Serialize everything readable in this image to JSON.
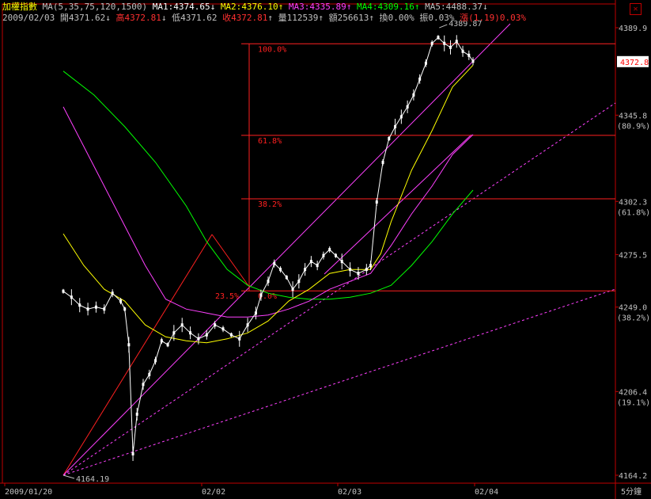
{
  "header": {
    "index_name": "加權指數",
    "ma_params": "MA(5,35,75,120,1500)",
    "ma1": {
      "label": "MA1:",
      "value": "4374.65",
      "arrow": "↓"
    },
    "ma2": {
      "label": "MA2:",
      "value": "4376.10",
      "arrow": "↑"
    },
    "ma3": {
      "label": "MA3:",
      "value": "4335.89",
      "arrow": "↑"
    },
    "ma4": {
      "label": "MA4:",
      "value": "4309.16",
      "arrow": "↑"
    },
    "ma5": {
      "label": "MA5:",
      "value": "4488.37",
      "arrow": "↓"
    },
    "date": "2009/02/03",
    "open": {
      "label": "開",
      "value": "4371.62",
      "arrow": "↓"
    },
    "high": {
      "label": "高",
      "value": "4372.81",
      "arrow": "↓"
    },
    "low": {
      "label": "低",
      "value": "4371.62"
    },
    "close": {
      "label": "收",
      "value": "4372.81",
      "arrow": "↑"
    },
    "volume": {
      "label": "量",
      "value": "112539",
      "arrow": "↑"
    },
    "amount": {
      "label": "額",
      "value": "256613",
      "arrow": "↑"
    },
    "turnover": {
      "label": "換",
      "value": "0.00%"
    },
    "amplitude": {
      "label": "振",
      "value": "0.03%"
    },
    "change": {
      "label": "漲",
      "value": "(1.19)",
      "pct": "0.03%"
    }
  },
  "period_label": "5分鐘",
  "close_icon": "close-icon",
  "colors": {
    "background": "#000000",
    "grid": "#c00000",
    "candle_up": "#ffffff",
    "candle_down": "#ffffff",
    "ma1": "#ffffff",
    "ma2": "#ffff00",
    "ma3": "#ff40ff",
    "ma4": "#00ff00",
    "ma5": "#00ff00",
    "fib": "#ff2020",
    "fan": "#ff40ff",
    "fan_red": "#ff2020",
    "axis_text": "#c0c0c0"
  },
  "chart_data": {
    "type": "line",
    "title": "加權指數",
    "y_ticks": [
      {
        "value": 4389.9,
        "label": "4389.9"
      },
      {
        "value": 4345.8,
        "label": "4345.8",
        "sub": "(80.9%)"
      },
      {
        "value": 4302.3,
        "label": "4302.3",
        "sub": "(61.8%)"
      },
      {
        "value": 4275.5,
        "label": "4275.5"
      },
      {
        "value": 4249.0,
        "label": "4249.0",
        "sub": "(38.2%)"
      },
      {
        "value": 4206.4,
        "label": "4206.4",
        "sub": "(19.1%)"
      },
      {
        "value": 4164.2,
        "label": "4164.2"
      }
    ],
    "current_price": "4372.8",
    "x_ticks": [
      {
        "label": "2009/01/20",
        "index": 0
      },
      {
        "label": "02/02",
        "index": 193
      },
      {
        "label": "02/03",
        "index": 306
      },
      {
        "label": "02/04",
        "index": 426
      }
    ],
    "x_count": 560,
    "annotations": {
      "high": {
        "text": "4389.87",
        "index": 367,
        "value": 4389.87
      },
      "low": {
        "text": "4164.19",
        "index": 0,
        "value": 4164.19
      }
    },
    "fib_levels": [
      {
        "label": "100.0%",
        "value": 4381.8
      },
      {
        "label": "61.8%",
        "value": 4335.6
      },
      {
        "label": "38.2%",
        "value": 4303.6
      },
      {
        "label": "23.5%",
        "value": 4257.2
      },
      {
        "label": "0.0%",
        "value": 4257.2
      }
    ],
    "close_series": [
      [
        0,
        4257
      ],
      [
        8,
        4254
      ],
      [
        16,
        4250
      ],
      [
        24,
        4248
      ],
      [
        32,
        4249
      ],
      [
        40,
        4248
      ],
      [
        48,
        4256
      ],
      [
        56,
        4252
      ],
      [
        60,
        4248
      ],
      [
        64,
        4230
      ],
      [
        68,
        4175
      ],
      [
        72,
        4195
      ],
      [
        78,
        4210
      ],
      [
        84,
        4215
      ],
      [
        90,
        4222
      ],
      [
        96,
        4232
      ],
      [
        102,
        4230
      ],
      [
        108,
        4236
      ],
      [
        116,
        4240
      ],
      [
        124,
        4236
      ],
      [
        132,
        4233
      ],
      [
        140,
        4235
      ],
      [
        148,
        4240
      ],
      [
        156,
        4238
      ],
      [
        164,
        4235
      ],
      [
        172,
        4233
      ],
      [
        180,
        4240
      ],
      [
        188,
        4246
      ],
      [
        193,
        4255
      ],
      [
        200,
        4262
      ],
      [
        206,
        4271
      ],
      [
        212,
        4268
      ],
      [
        218,
        4264
      ],
      [
        224,
        4258
      ],
      [
        230,
        4262
      ],
      [
        236,
        4268
      ],
      [
        242,
        4272
      ],
      [
        248,
        4270
      ],
      [
        254,
        4275
      ],
      [
        260,
        4278
      ],
      [
        266,
        4275
      ],
      [
        272,
        4272
      ],
      [
        280,
        4268
      ],
      [
        288,
        4266
      ],
      [
        296,
        4268
      ],
      [
        300,
        4270
      ],
      [
        306,
        4302
      ],
      [
        312,
        4322
      ],
      [
        318,
        4334
      ],
      [
        324,
        4340
      ],
      [
        330,
        4345
      ],
      [
        336,
        4350
      ],
      [
        342,
        4356
      ],
      [
        348,
        4364
      ],
      [
        354,
        4372
      ],
      [
        360,
        4382
      ],
      [
        366,
        4385
      ],
      [
        372,
        4382
      ],
      [
        378,
        4380
      ],
      [
        384,
        4383
      ],
      [
        390,
        4378
      ],
      [
        396,
        4376
      ],
      [
        400,
        4373
      ]
    ],
    "ma2_series": [
      [
        0,
        4286
      ],
      [
        20,
        4270
      ],
      [
        40,
        4258
      ],
      [
        60,
        4252
      ],
      [
        80,
        4240
      ],
      [
        100,
        4234
      ],
      [
        120,
        4232
      ],
      [
        140,
        4231
      ],
      [
        160,
        4233
      ],
      [
        180,
        4236
      ],
      [
        200,
        4242
      ],
      [
        220,
        4252
      ],
      [
        240,
        4258
      ],
      [
        260,
        4266
      ],
      [
        280,
        4268
      ],
      [
        300,
        4268
      ],
      [
        310,
        4276
      ],
      [
        320,
        4292
      ],
      [
        340,
        4318
      ],
      [
        360,
        4338
      ],
      [
        380,
        4360
      ],
      [
        400,
        4371
      ]
    ],
    "ma3_series": [
      [
        0,
        4350
      ],
      [
        20,
        4330
      ],
      [
        40,
        4310
      ],
      [
        60,
        4290
      ],
      [
        80,
        4270
      ],
      [
        100,
        4253
      ],
      [
        120,
        4248
      ],
      [
        140,
        4246
      ],
      [
        160,
        4244
      ],
      [
        180,
        4244
      ],
      [
        200,
        4245
      ],
      [
        220,
        4248
      ],
      [
        240,
        4252
      ],
      [
        260,
        4258
      ],
      [
        280,
        4262
      ],
      [
        300,
        4266
      ],
      [
        320,
        4280
      ],
      [
        340,
        4296
      ],
      [
        360,
        4310
      ],
      [
        380,
        4326
      ],
      [
        400,
        4336
      ]
    ],
    "ma4_series": [
      [
        0,
        4368
      ],
      [
        30,
        4356
      ],
      [
        60,
        4340
      ],
      [
        90,
        4322
      ],
      [
        120,
        4300
      ],
      [
        140,
        4282
      ],
      [
        160,
        4268
      ],
      [
        180,
        4260
      ],
      [
        200,
        4256
      ],
      [
        220,
        4254
      ],
      [
        240,
        4253
      ],
      [
        260,
        4253
      ],
      [
        280,
        4254
      ],
      [
        300,
        4256
      ],
      [
        320,
        4260
      ],
      [
        340,
        4270
      ],
      [
        360,
        4282
      ],
      [
        380,
        4296
      ],
      [
        400,
        4308
      ]
    ]
  }
}
